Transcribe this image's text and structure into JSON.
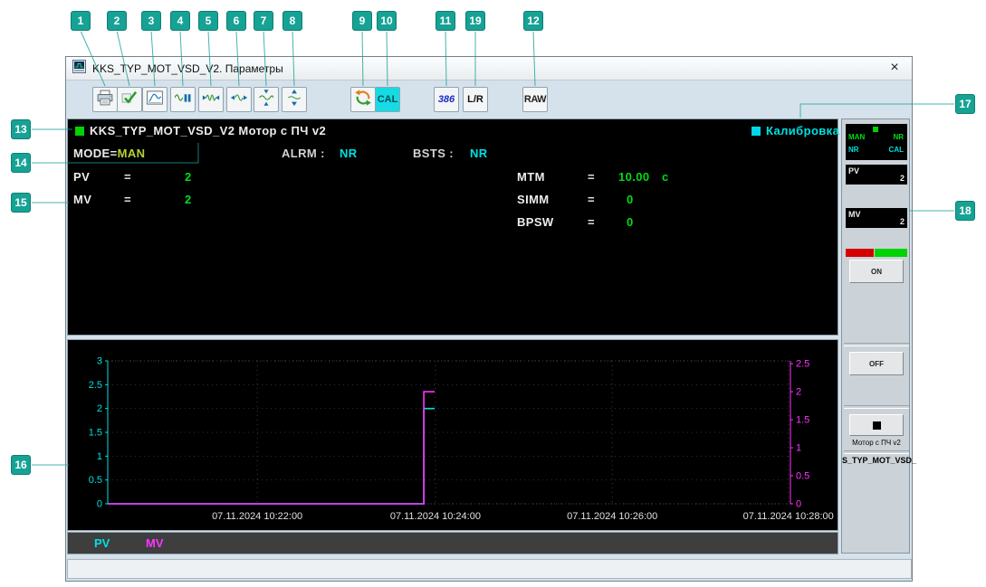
{
  "callouts": {
    "numbers": [
      "1",
      "2",
      "3",
      "4",
      "5",
      "6",
      "7",
      "8",
      "9",
      "10",
      "11",
      "19",
      "12",
      "13",
      "14",
      "15",
      "16",
      "17",
      "18"
    ]
  },
  "window": {
    "title": "KKS_TYP_MOT_VSD_V2. Параметры",
    "close_label": "×"
  },
  "toolbar": {
    "cal_label": "CAL",
    "x386_label": "386",
    "lr_label": "L/R",
    "raw_label": "RAW"
  },
  "panel": {
    "title": "KKS_TYP_MOT_VSD_V2 Мотор с ПЧ v2",
    "calibration_label": "Калибровка",
    "mode_label": "MODE=",
    "mode_value": "MAN",
    "alrm_label": "ALRM :",
    "alrm_value": "NR",
    "bsts_label": "BSTS :",
    "bsts_value": "NR",
    "params_left": [
      {
        "name": "PV",
        "eq": "=",
        "value": "2"
      },
      {
        "name": "MV",
        "eq": "=",
        "value": "2"
      }
    ],
    "params_right": [
      {
        "name": "MTM",
        "eq": "=",
        "value": "10.00",
        "unit": "c"
      },
      {
        "name": "SIMM",
        "eq": "=",
        "value": "0",
        "unit": ""
      },
      {
        "name": "BPSW",
        "eq": "=",
        "value": "0",
        "unit": ""
      }
    ]
  },
  "chart_data": {
    "type": "line",
    "title": "",
    "xlabel": "",
    "ylabel": "",
    "grid": true,
    "x_ticks": [
      {
        "frac": 0.219,
        "label": "07.11.2024 10:22:00"
      },
      {
        "frac": 0.48,
        "label": "07.11.2024 10:24:00"
      },
      {
        "frac": 0.739,
        "label": "07.11.2024 10:26:00"
      },
      {
        "frac": 0.997,
        "label": "07.11.2024 10:28:00"
      }
    ],
    "left_axis": {
      "color": "#00e0e0",
      "min": 0,
      "max": 3,
      "ticks": [
        0,
        0.5,
        1,
        1.5,
        2,
        2.5,
        3
      ]
    },
    "right_axis": {
      "color": "#ff33ff",
      "min": 0,
      "max": 2.55,
      "ticks": [
        0,
        0.5,
        1,
        1.5,
        2,
        2.5
      ]
    },
    "series": [
      {
        "name": "PV",
        "color": "#00e0e0",
        "axis": "left",
        "points": [
          [
            0,
            0
          ],
          [
            0.463,
            0
          ],
          [
            0.463,
            2
          ],
          [
            0.479,
            2
          ]
        ]
      },
      {
        "name": "MV",
        "color": "#ff33ff",
        "axis": "right",
        "points": [
          [
            0,
            0
          ],
          [
            0.463,
            0
          ],
          [
            0.463,
            2
          ],
          [
            0.479,
            2
          ]
        ]
      }
    ]
  },
  "legend": {
    "pv_label": "PV",
    "mv_label": "MV"
  },
  "faceplate": {
    "status": {
      "line1_left": "MAN",
      "line1_right": "NR",
      "line2_left": "NR",
      "line2_right": "CAL"
    },
    "pv_label": "PV",
    "pv_value": "2",
    "mv_label": "MV",
    "mv_value": "2",
    "on_label": "ON",
    "off_label": "OFF",
    "motor_label": "Мотор с ПЧ v2",
    "tag_label": "S_TYP_MOT_VSD_"
  }
}
